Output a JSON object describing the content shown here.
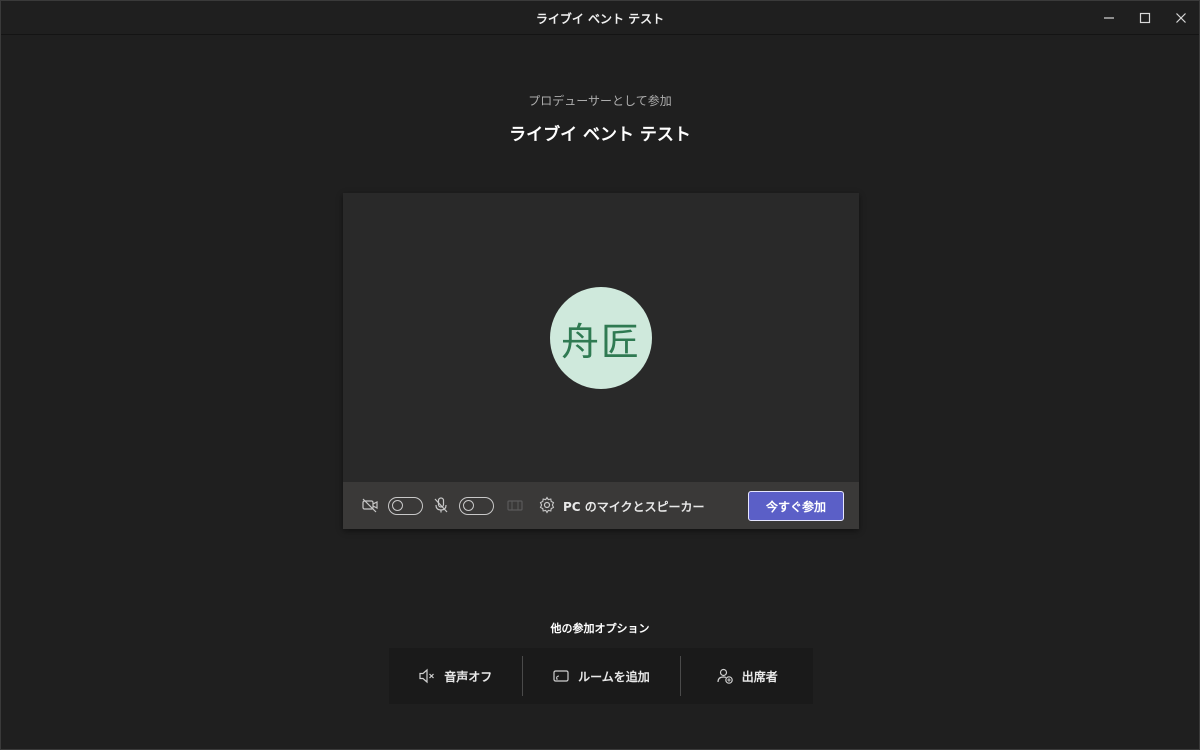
{
  "window": {
    "title": "ライブイ ベント テスト",
    "controls": [
      "minimize-icon",
      "maximize-icon",
      "close-icon"
    ]
  },
  "join": {
    "subtitle": "プロデューサーとして参加",
    "meeting_title": "ライブイ ベント テスト",
    "avatar_initials": "舟匠",
    "audio_device_label": "PC のマイクとスピーカー",
    "join_button_label": "今すぐ参加",
    "camera_on": false,
    "mic_on": false
  },
  "other_options": {
    "heading": "他の参加オプション",
    "items": [
      {
        "label": "音声オフ",
        "icon": "speaker-off-icon"
      },
      {
        "label": "ルームを追加",
        "icon": "cast-room-icon"
      },
      {
        "label": "出席者",
        "icon": "add-person-icon"
      }
    ]
  },
  "colors": {
    "background": "#1f1f1f",
    "preview": "#292929",
    "controls_bar": "#3a3938",
    "accent": "#5b5fc7",
    "avatar_bg": "#cfe9dc",
    "avatar_text": "#2f7a52"
  }
}
